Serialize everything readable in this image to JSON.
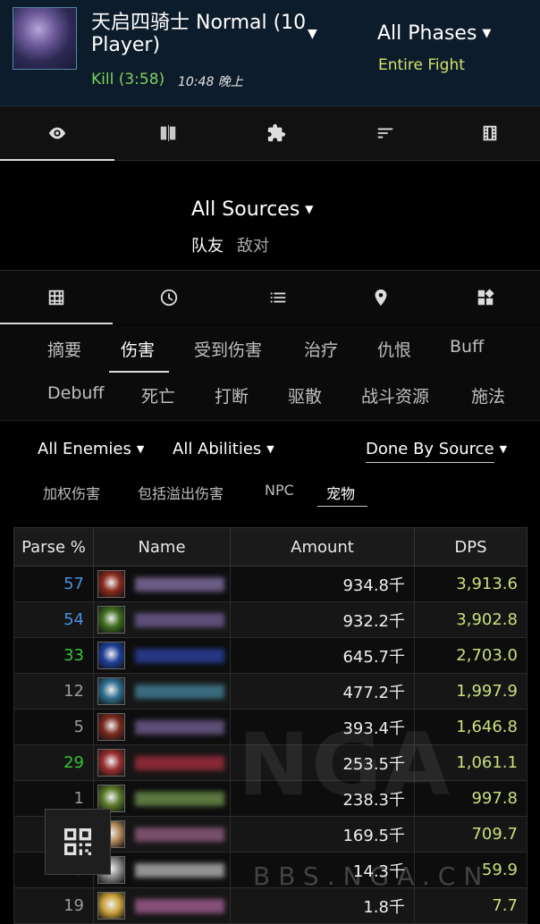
{
  "header": {
    "boss_name": "天启四骑士 Normal (10 Player)",
    "kill": "Kill (3:58)",
    "time": "10:48 晚上",
    "phases": "All Phases",
    "phase_sub": "Entire Fight"
  },
  "top_tabs": [
    "eye-icon",
    "compare-icon",
    "puzzle-icon",
    "sort-icon",
    "film-icon"
  ],
  "sources": {
    "label": "All Sources",
    "ally": "队友",
    "enemy": "敌对"
  },
  "mid_tabs": [
    "grid-icon",
    "clock-icon",
    "list-icon",
    "location-icon",
    "widgets-icon"
  ],
  "categories": {
    "row1": [
      "摘要",
      "伤害",
      "受到伤害",
      "治疗",
      "仇恨",
      "Buff"
    ],
    "row2": [
      "Debuff",
      "死亡",
      "打断",
      "驱散",
      "战斗资源",
      "施法"
    ],
    "active": "伤害"
  },
  "filters": {
    "enemies": "All Enemies",
    "abilities": "All Abilities",
    "done_by": "Done By Source"
  },
  "options": [
    "加权伤害",
    "包括溢出伤害",
    "NPC",
    "宠物"
  ],
  "table": {
    "headers": [
      "Parse %",
      "Name",
      "Amount",
      "DPS"
    ],
    "rows": [
      {
        "parse": "57",
        "amount": "934.8千",
        "dps": "3,913.6",
        "color": "#4a8fe0"
      },
      {
        "parse": "54",
        "amount": "932.2千",
        "dps": "3,902.8",
        "color": "#4a8fe0"
      },
      {
        "parse": "33",
        "amount": "645.7千",
        "dps": "2,703.0",
        "color": "#36c236"
      },
      {
        "parse": "12",
        "amount": "477.2千",
        "dps": "1,997.9",
        "color": "#9a9a9a"
      },
      {
        "parse": "5",
        "amount": "393.4千",
        "dps": "1,646.8",
        "color": "#9a9a9a"
      },
      {
        "parse": "29",
        "amount": "253.5千",
        "dps": "1,061.1",
        "color": "#36c236"
      },
      {
        "parse": "1",
        "amount": "238.3千",
        "dps": "997.8",
        "color": "#9a9a9a"
      },
      {
        "parse": "",
        "amount": "169.5千",
        "dps": "709.7",
        "color": "#9a9a9a"
      },
      {
        "parse": "70",
        "amount": "14.3千",
        "dps": "59.9",
        "color": "#4a8fe0"
      },
      {
        "parse": "19",
        "amount": "1.8千",
        "dps": "7.7",
        "color": "#9a9a9a"
      }
    ]
  },
  "watermark": {
    "logo": "NGA",
    "url": "BBS.NGA.CN"
  },
  "colors": {
    "header_bg": "#0d1c2b",
    "kill_green": "#7ed05a",
    "phase_yellow": "#d3e26b",
    "dps_green": "#c8e07a"
  }
}
